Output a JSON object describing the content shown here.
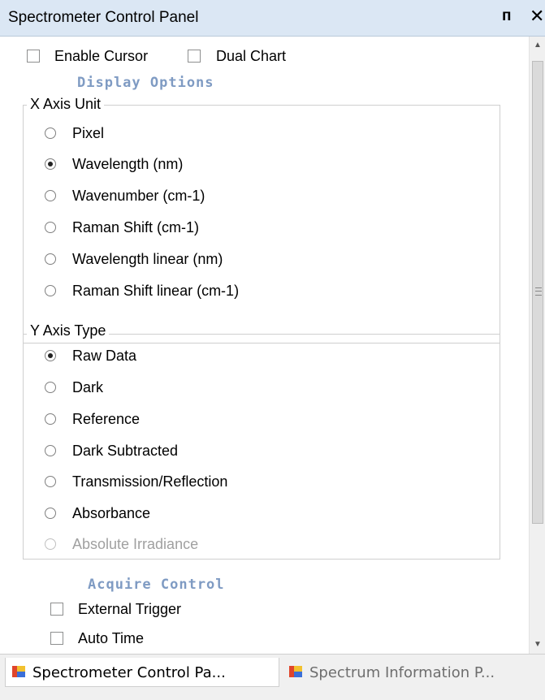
{
  "panel": {
    "title": "Spectrometer Control Panel",
    "pin_glyph": "Ԅ",
    "close_glyph": "×"
  },
  "top_options": {
    "enable_cursor": {
      "label": "Enable Cursor",
      "checked": false
    },
    "dual_chart": {
      "label": "Dual Chart",
      "checked": false
    }
  },
  "display_options": {
    "title": "Display Options",
    "x_axis": {
      "legend": "X Axis Unit",
      "selected": "Wavelength (nm)",
      "options": [
        "Pixel",
        "Wavelength (nm)",
        "Wavenumber (cm-1)",
        "Raman Shift (cm-1)",
        "Wavelength linear (nm)",
        "Raman Shift linear (cm-1)"
      ]
    },
    "y_axis": {
      "legend": "Y Axis Type",
      "selected": "Raw Data",
      "options": [
        "Raw Data",
        "Dark",
        "Reference",
        "Dark Subtracted",
        "Transmission/Reflection",
        "Absorbance",
        "Absolute Irradiance"
      ],
      "disabled": [
        "Absolute Irradiance"
      ]
    }
  },
  "acquire_control": {
    "title": "Acquire Control",
    "external_trigger": {
      "label": "External Trigger",
      "checked": false
    },
    "auto_time": {
      "label": "Auto Time",
      "checked": false
    }
  },
  "tabs": [
    {
      "label": "Spectrometer Control Pa...",
      "active": true
    },
    {
      "label": "Spectrum Information P...",
      "active": false
    }
  ],
  "colors": {
    "title_bar": "#dbe7f4",
    "section_title": "#7f9bc3",
    "disabled_text": "#a0a0a0",
    "tab_icon_red": "#e0452b",
    "tab_icon_yellow": "#f2c12e",
    "tab_icon_blue": "#3a6fd8"
  }
}
